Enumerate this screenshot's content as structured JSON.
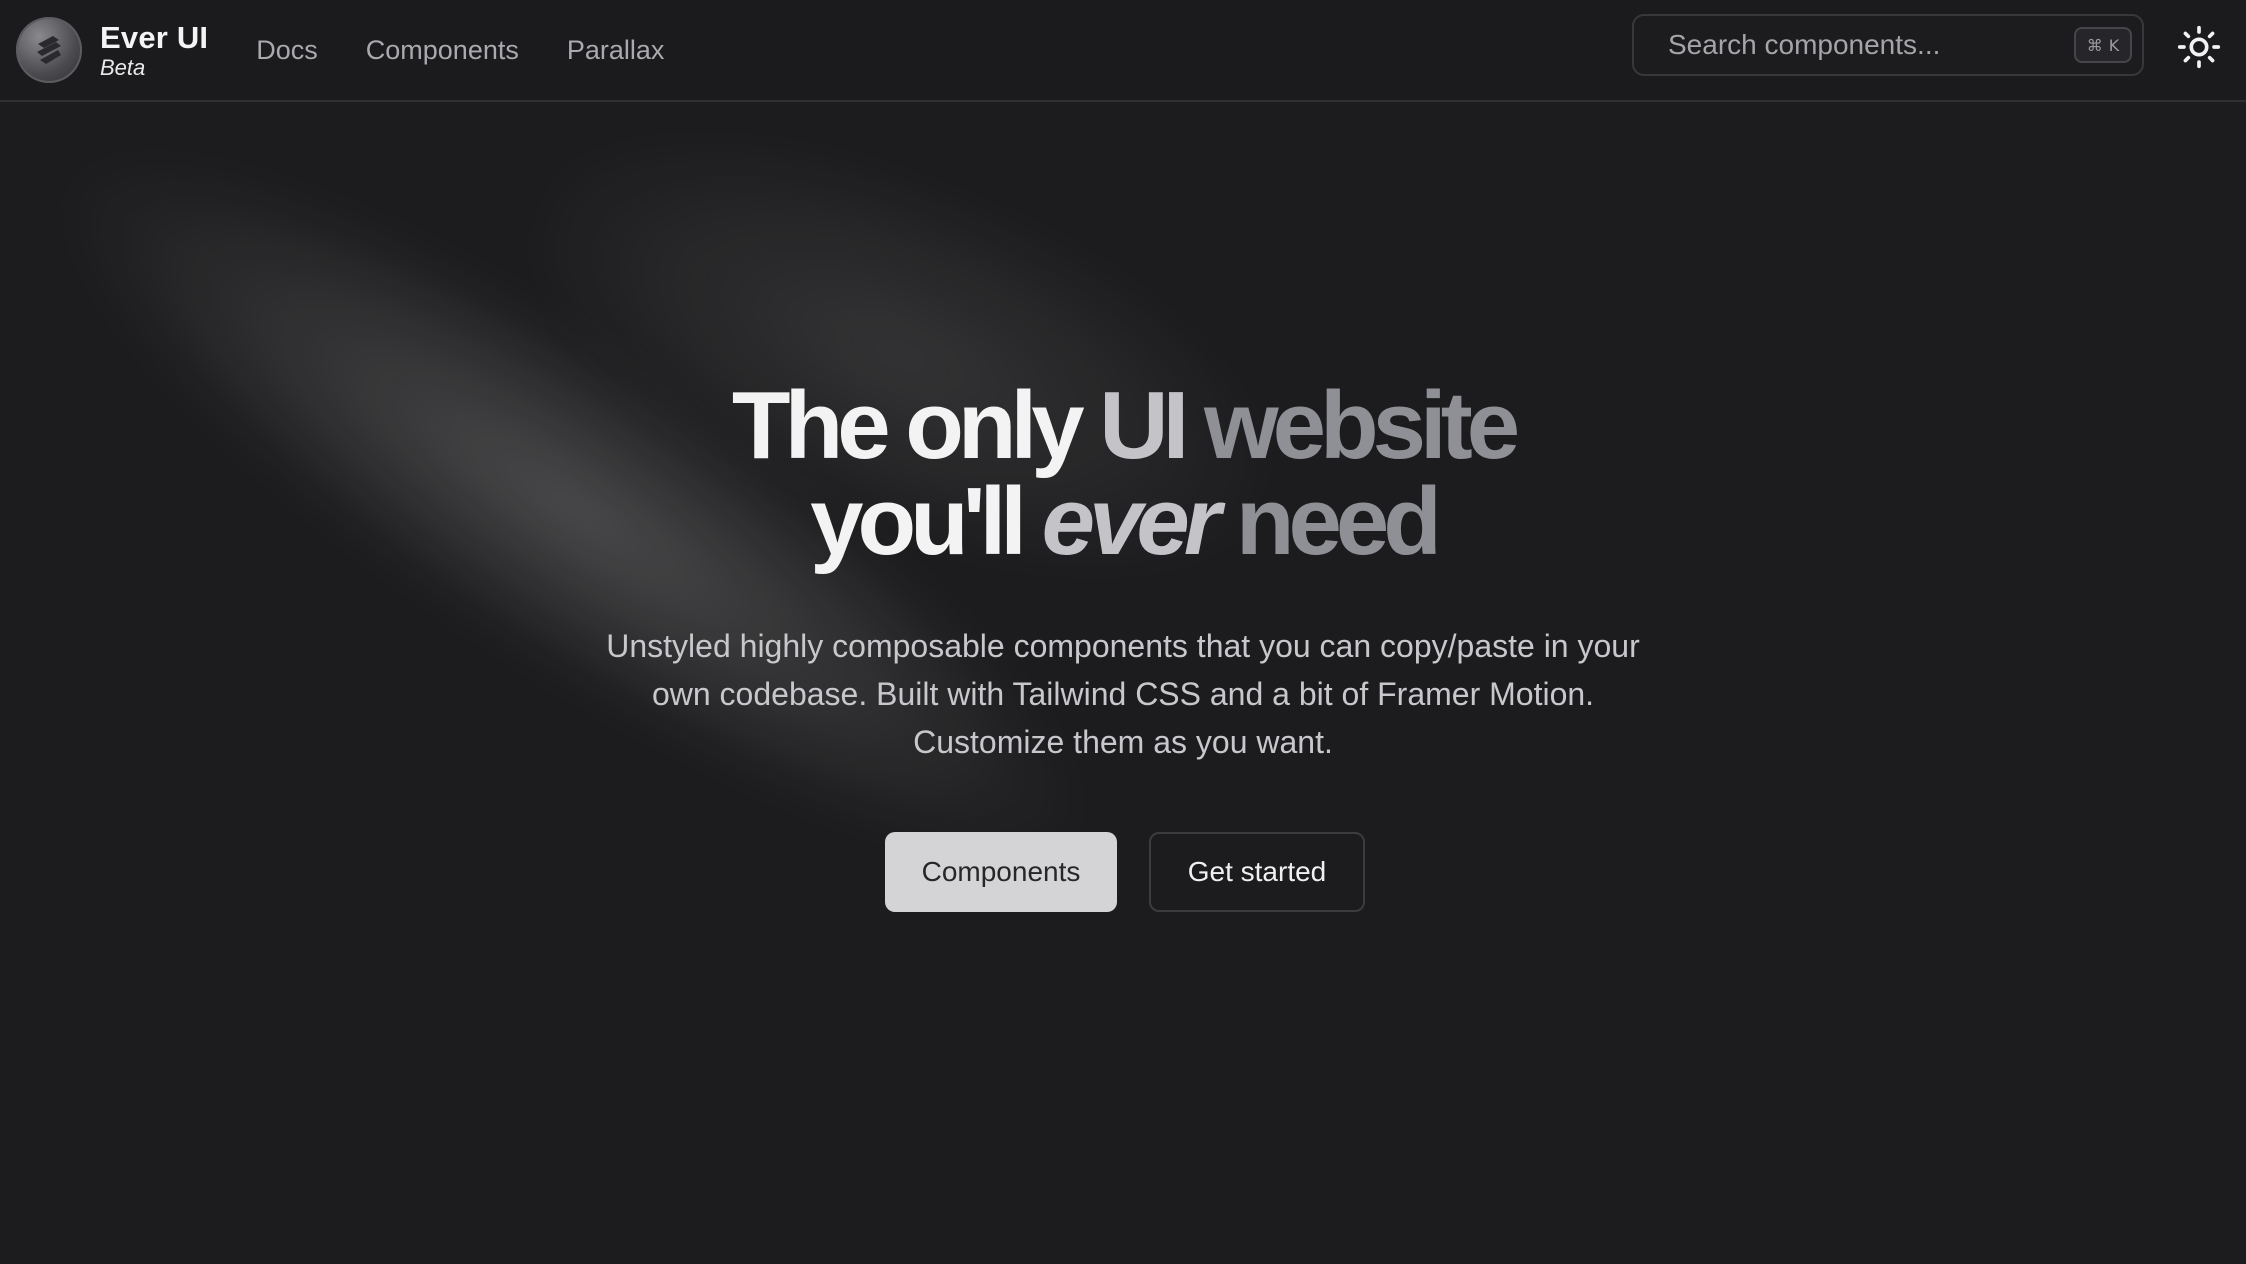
{
  "brand": {
    "name": "Ever UI",
    "tag": "Beta"
  },
  "nav": {
    "items": [
      {
        "label": "Docs"
      },
      {
        "label": "Components"
      },
      {
        "label": "Parallax"
      }
    ]
  },
  "search": {
    "placeholder": "Search components...",
    "shortcut_symbol": "⌘",
    "shortcut_key": "K"
  },
  "theme_toggle": {
    "icon": "sun-icon"
  },
  "hero": {
    "line1": {
      "part1": "The only",
      "part2": "UI",
      "part3": "website"
    },
    "line2": {
      "part1": "you'll",
      "part2": "ever",
      "part3": "need"
    },
    "description": "Unstyled highly composable components that you can copy/paste in your own codebase. Built with Tailwind CSS and a bit of Framer Motion. Customize them as you want.",
    "primary_button": "Components",
    "secondary_button": "Get started"
  },
  "colors": {
    "background": "#1c1c1e",
    "primary_button_bg": "#d4d4d6",
    "heading_bright": "#f3f3f4",
    "heading_dim": "#8f8f96"
  }
}
